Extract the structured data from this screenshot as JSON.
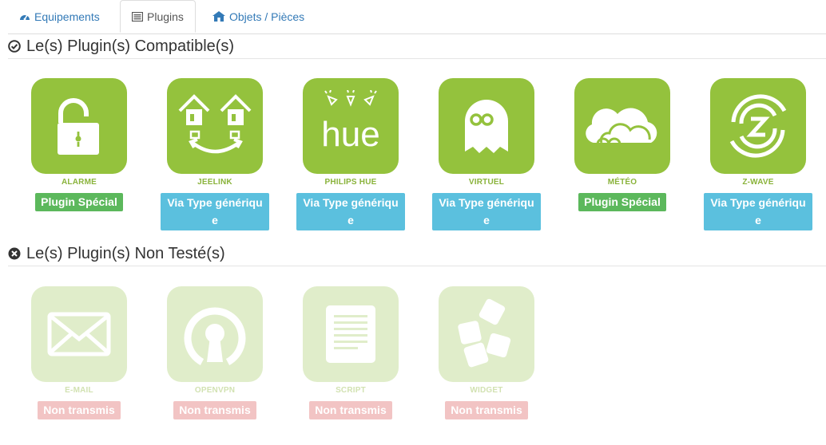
{
  "tabs": [
    {
      "label": "Equipements",
      "icon": "tachometer-icon"
    },
    {
      "label": "Plugins",
      "icon": "list-alt-icon"
    },
    {
      "label": "Objets / Pièces",
      "icon": "home-icon"
    }
  ],
  "sections": {
    "compatible": {
      "title": "Le(s) Plugin(s) Compatible(s)",
      "icon": "check-circle-icon"
    },
    "untested": {
      "title": "Le(s) Plugin(s) Non Testé(s)",
      "icon": "times-circle-icon"
    }
  },
  "compatible_plugins": [
    {
      "name": "ALARME",
      "icon": "padlock-icon",
      "badge": "Plugin Spécial"
    },
    {
      "name": "JEELINK",
      "icon": "houses-link-icon",
      "badge": "Via Type générique"
    },
    {
      "name": "PHILIPS HUE",
      "icon": "hue-icon",
      "badge": "Via Type générique",
      "logo_text": "hue"
    },
    {
      "name": "VIRTUEL",
      "icon": "ghost-icon",
      "badge": "Via Type générique"
    },
    {
      "name": "MÉTÉO",
      "icon": "cloud-icon",
      "badge": "Plugin Spécial"
    },
    {
      "name": "Z-WAVE",
      "icon": "zwave-icon",
      "badge": "Via Type générique"
    }
  ],
  "untested_plugins": [
    {
      "name": "E-MAIL",
      "icon": "envelope-icon",
      "badge": "Non transmis"
    },
    {
      "name": "OPENVPN",
      "icon": "openvpn-icon",
      "badge": "Non transmis"
    },
    {
      "name": "SCRIPT",
      "icon": "script-icon",
      "badge": "Non transmis"
    },
    {
      "name": "WIDGET",
      "icon": "widget-icon",
      "badge": "Non transmis"
    }
  ],
  "colors": {
    "accent_green": "#94c23d",
    "faded_green": "#e0edca",
    "badge_green": "#5cb85c",
    "badge_blue": "#5bc0de",
    "badge_pink": "#f2c4c4",
    "link_blue": "#337ab7"
  }
}
